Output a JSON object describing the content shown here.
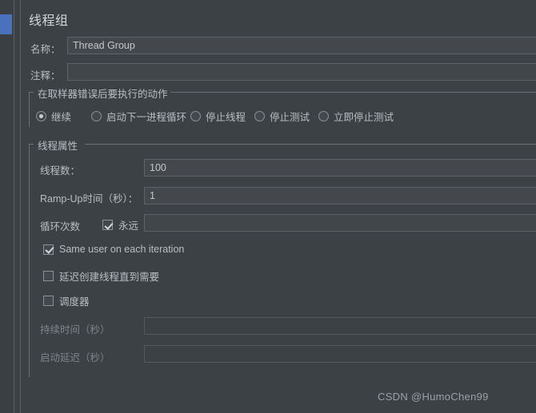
{
  "window": {
    "page_title": "线程组",
    "accent_selection_color": "#4a71bd",
    "panel_bg_color": "#3c4145"
  },
  "tree": {
    "selected_node_name": "线程组"
  },
  "basic": {
    "name_label": "名称：",
    "name_value": "Thread Group",
    "comment_label": "注释：",
    "comment_value": "",
    "comment_placeholder": ""
  },
  "on_sampler_error": {
    "group_title": "在取样器错误后要执行的动作",
    "selected_index": 0,
    "options": [
      {
        "label": "继续",
        "checked": true
      },
      {
        "label": "启动下一进程循环",
        "checked": false
      },
      {
        "label": "停止线程",
        "checked": false
      },
      {
        "label": "停止测试",
        "checked": false
      },
      {
        "label": "立即停止测试",
        "checked": false
      }
    ]
  },
  "thread_properties": {
    "group_title": "线程属性",
    "num_threads_label": "线程数：",
    "num_threads_value": "100",
    "ramp_up_label": "Ramp-Up时间（秒）：",
    "ramp_up_value": "1",
    "loop_count_label": "循环次数",
    "loop_forever_label": "永远",
    "loop_forever_checked": true,
    "loop_count_value": "",
    "same_user_label": "Same user on each iteration",
    "same_user_checked": true,
    "delay_create_label": "延迟创建线程直到需要",
    "delay_create_checked": false,
    "scheduler_label": "调度器",
    "scheduler_checked": false,
    "duration_label": "持续时间（秒）",
    "duration_value": "",
    "duration_disabled": true,
    "startup_delay_label": "启动延迟（秒）",
    "startup_delay_value": "",
    "startup_delay_disabled": true
  },
  "watermark": {
    "text": "CSDN @HumoChen99"
  }
}
